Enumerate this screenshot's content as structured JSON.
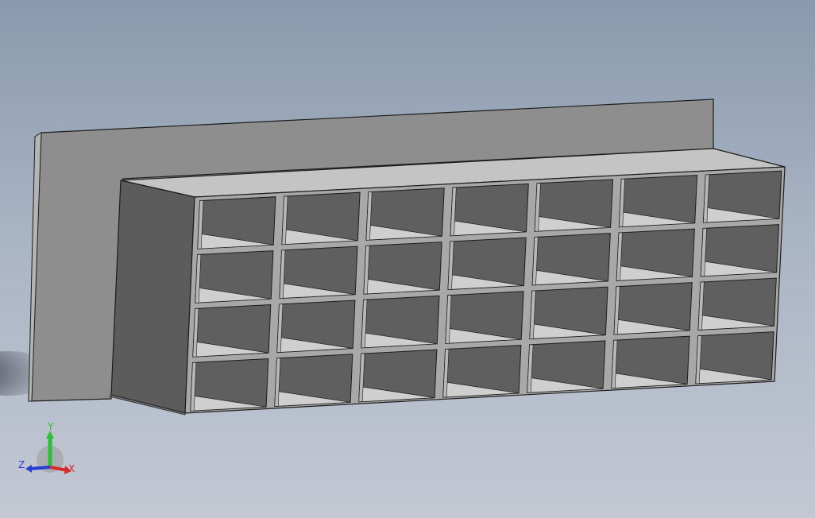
{
  "viewport": {
    "background_top": "#8a99ad",
    "background_bottom": "#c3c8d3"
  },
  "model": {
    "backboard_color": "#8e8e8e",
    "top_color": "#c4c4c4",
    "side_color": "#5c5c5c",
    "cubby_back_color": "#5f5f5f",
    "cubby_floor_color": "#cfcfcf",
    "edge_color": "#1c1c1c",
    "rows": 4,
    "columns": 7
  },
  "triad": {
    "x_label": "X",
    "y_label": "Y",
    "z_label": "Z",
    "x_color": "#d42a2a",
    "y_color": "#2bbf38",
    "z_color": "#2a3fcf"
  }
}
